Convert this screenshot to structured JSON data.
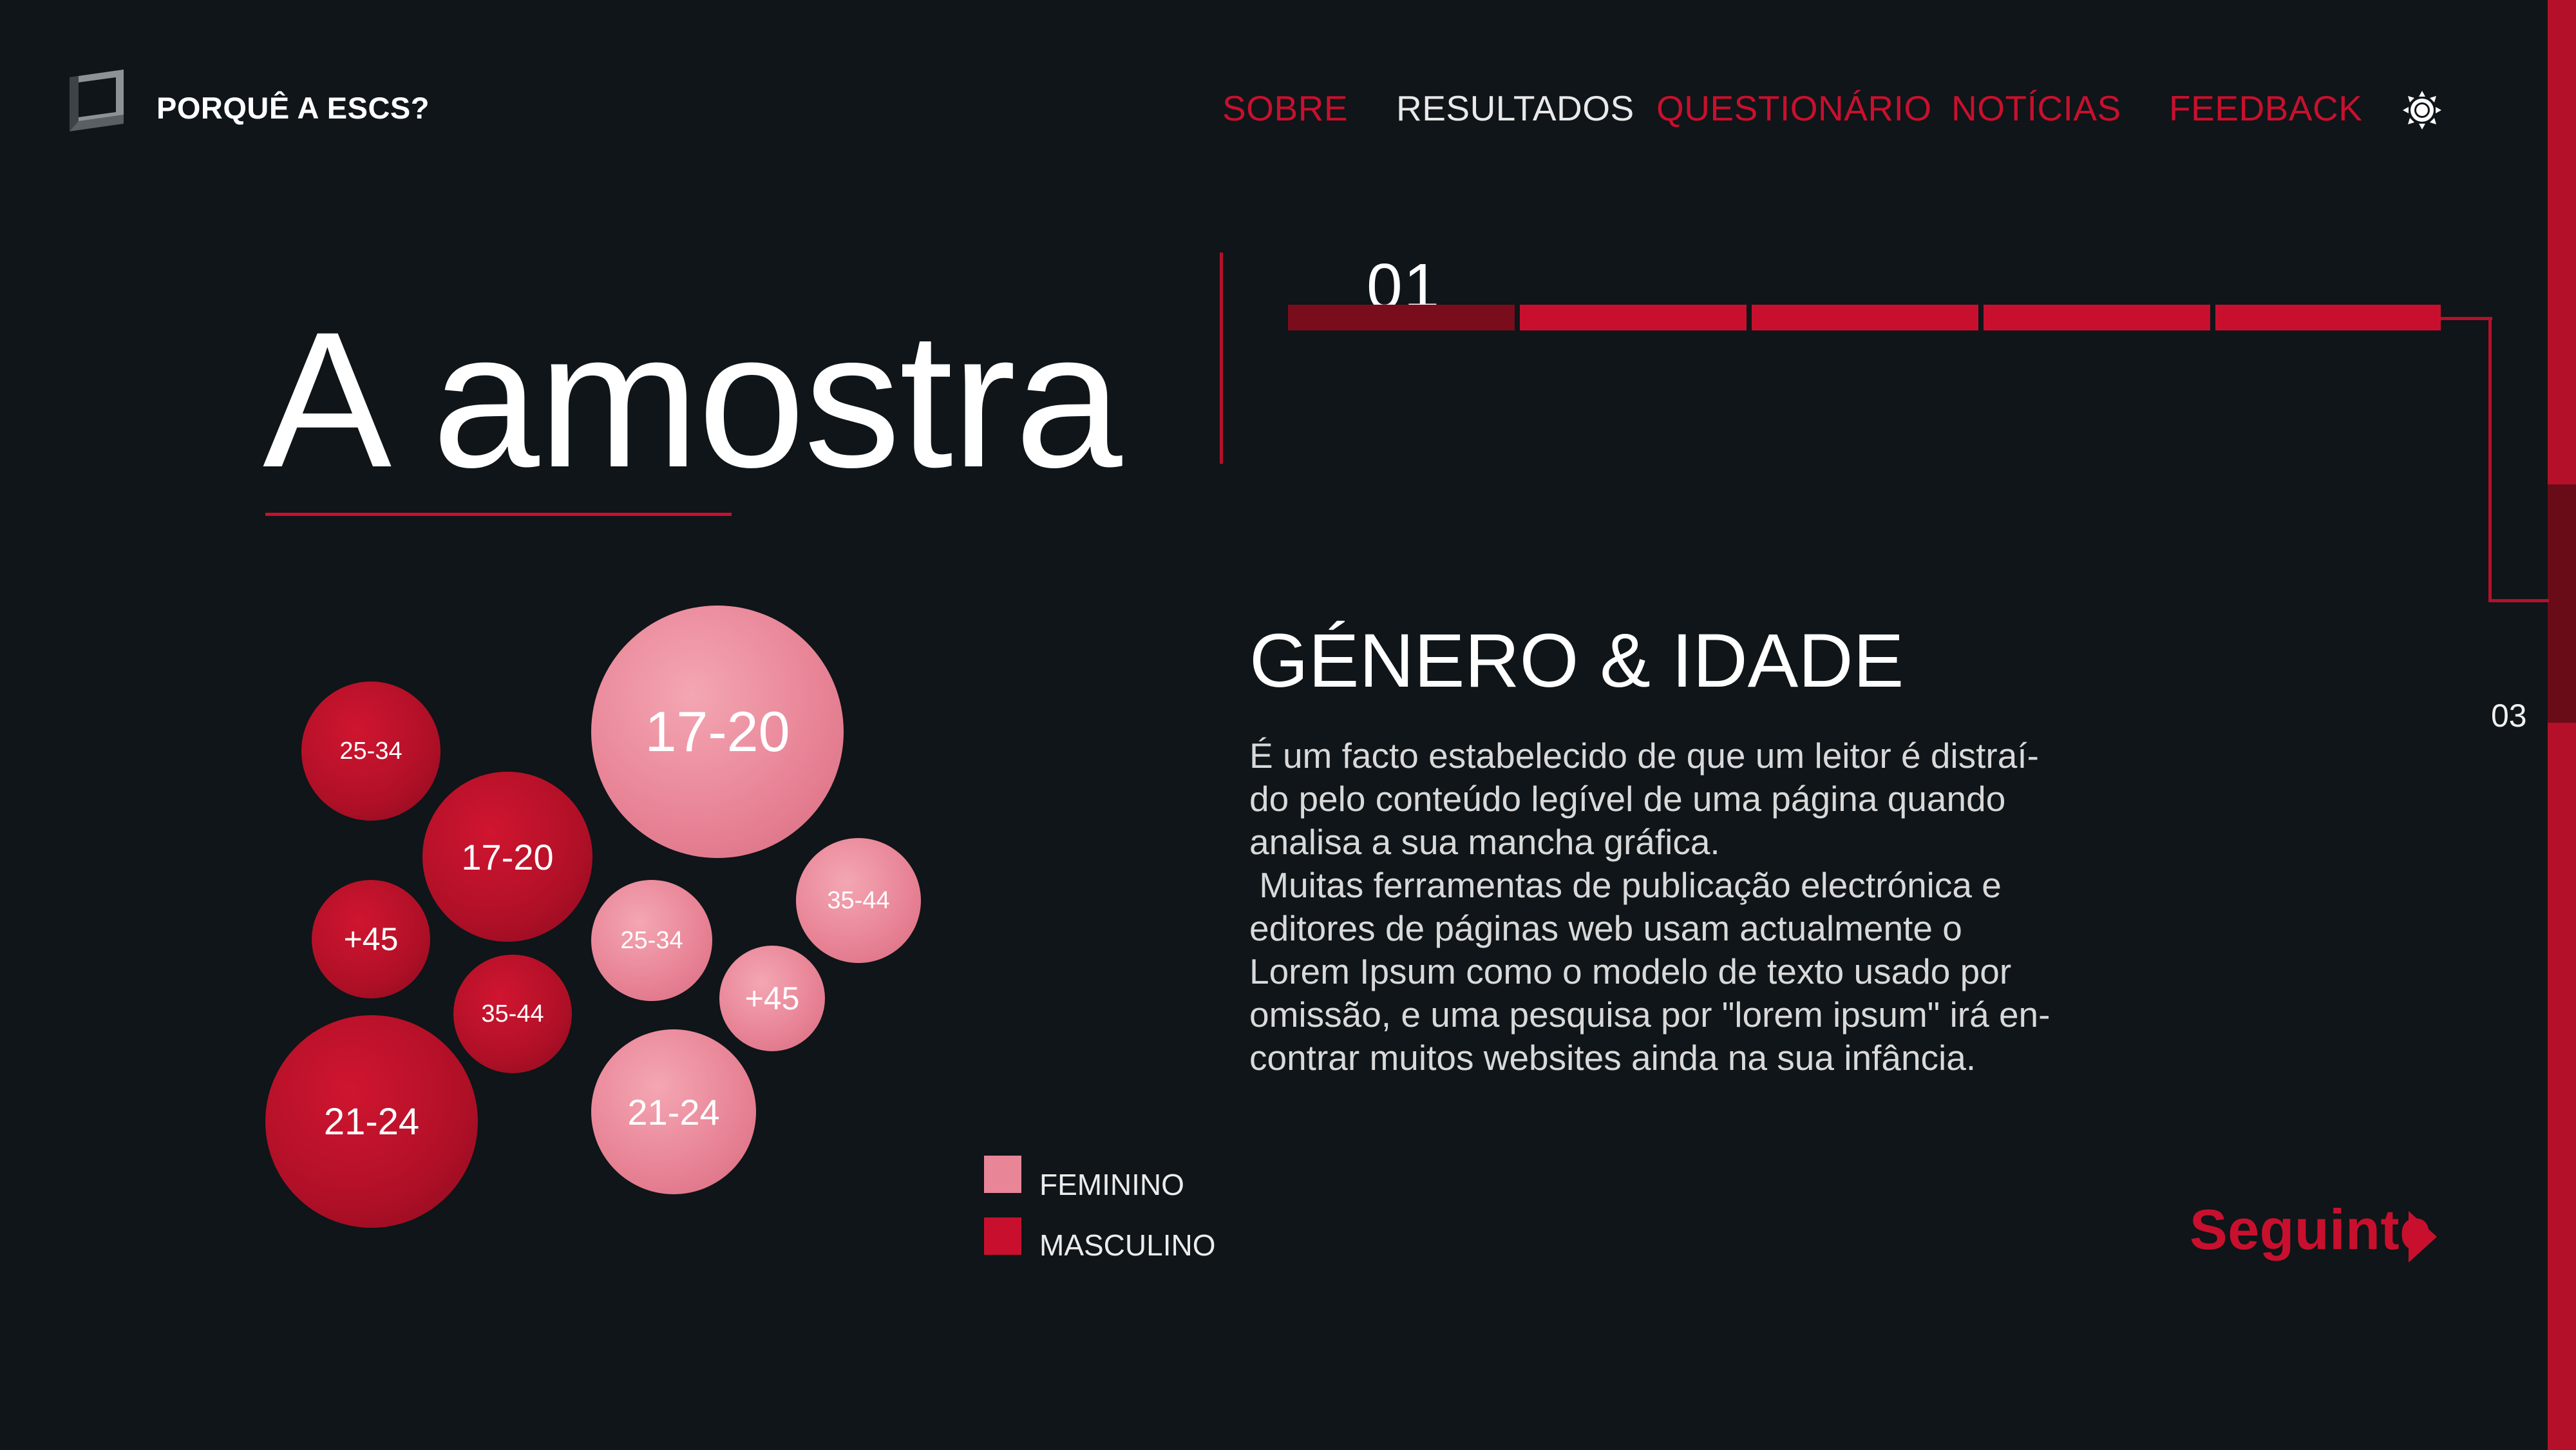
{
  "header": {
    "brand": "PORQUÊ A ESCS?",
    "nav": [
      {
        "label": "SOBRE",
        "active": false
      },
      {
        "label": "RESULTADOS",
        "active": true
      },
      {
        "label": "QUESTIONÁRIO",
        "active": false
      },
      {
        "label": "NOTÍCIAS",
        "active": false
      },
      {
        "label": "FEEDBACK",
        "active": false
      }
    ],
    "icons": {
      "logo": "cube-logo-icon",
      "theme": "sun-icon"
    }
  },
  "page": {
    "title": "A amostra",
    "step_current": "01",
    "step_side": "03",
    "progress": {
      "current_segment": 1,
      "total_segments": 5
    }
  },
  "section": {
    "title": "GÉNERO & IDADE",
    "paragraphs": [
      "É um facto estabelecido de que um leitor é distraí-do pelo conteúdo legível de uma página quando analisa a sua mancha gráfica.",
      " Muitas ferramentas de publicação electrónica e editores de páginas web usam actualmente o Lorem Ipsum como o modelo de texto usado por omissão, e uma pesquisa por \"lorem ipsum\" irá en-contrar muitos websites ainda na sua infância."
    ]
  },
  "bubbles": [
    {
      "label": "17-20",
      "group": "feminino"
    },
    {
      "label": "35-44",
      "group": "feminino"
    },
    {
      "label": "25-34",
      "group": "feminino"
    },
    {
      "label": "+45",
      "group": "feminino"
    },
    {
      "label": "21-24",
      "group": "feminino"
    },
    {
      "label": "25-34",
      "group": "masculino"
    },
    {
      "label": "17-20",
      "group": "masculino"
    },
    {
      "label": "+45",
      "group": "masculino"
    },
    {
      "label": "35-44",
      "group": "masculino"
    },
    {
      "label": "21-24",
      "group": "masculino"
    }
  ],
  "legend": [
    {
      "label": "FEMININO",
      "color": "#e88597"
    },
    {
      "label": "MASCULINO",
      "color": "#c8102e"
    }
  ],
  "colors": {
    "accent": "#c8102e",
    "background": "#0f1518",
    "feminino": "#e88597",
    "masculino": "#c8102e"
  },
  "footer": {
    "next_label": "Seguinte",
    "next_icon": "triangle-right-icon"
  }
}
